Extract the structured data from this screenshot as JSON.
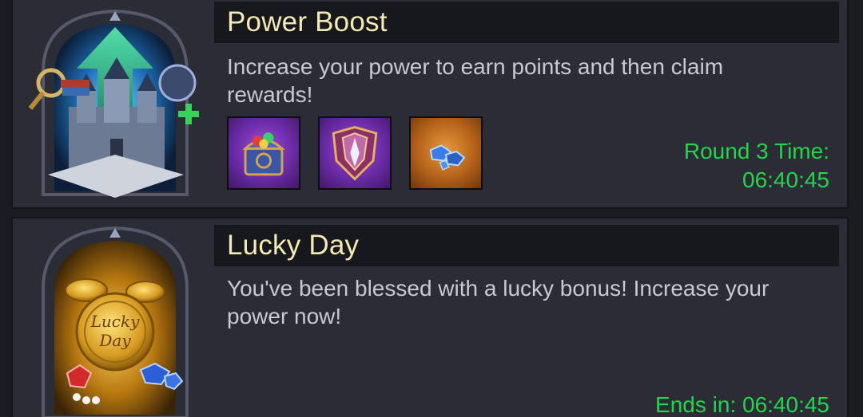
{
  "events": {
    "power_boost": {
      "title": "Power Boost",
      "description": "Increase your power to earn points and then claim rewards!",
      "icon": "castle-upgrade-icon",
      "rewards": [
        {
          "icon": "gem-chest-icon",
          "rarity": "purple"
        },
        {
          "icon": "rank-crest-icon",
          "rarity": "purple"
        },
        {
          "icon": "sapphire-gems-icon",
          "rarity": "orange"
        }
      ],
      "timer_label": "Round 3 Time:",
      "timer_value": "06:40:45"
    },
    "lucky_day": {
      "title": "Lucky Day",
      "description": "You've been blessed with a lucky bonus! Increase your power now!",
      "icon": "lucky-day-coin-icon",
      "coin_text_line1": "Lucky",
      "coin_text_line2": "Day",
      "timer_text": "Ends in: 06:40:45"
    }
  },
  "colors": {
    "title": "#f3e9b2",
    "description": "#c9c9d0",
    "timer": "#22d64a",
    "card_bg": "#2b2c36"
  }
}
